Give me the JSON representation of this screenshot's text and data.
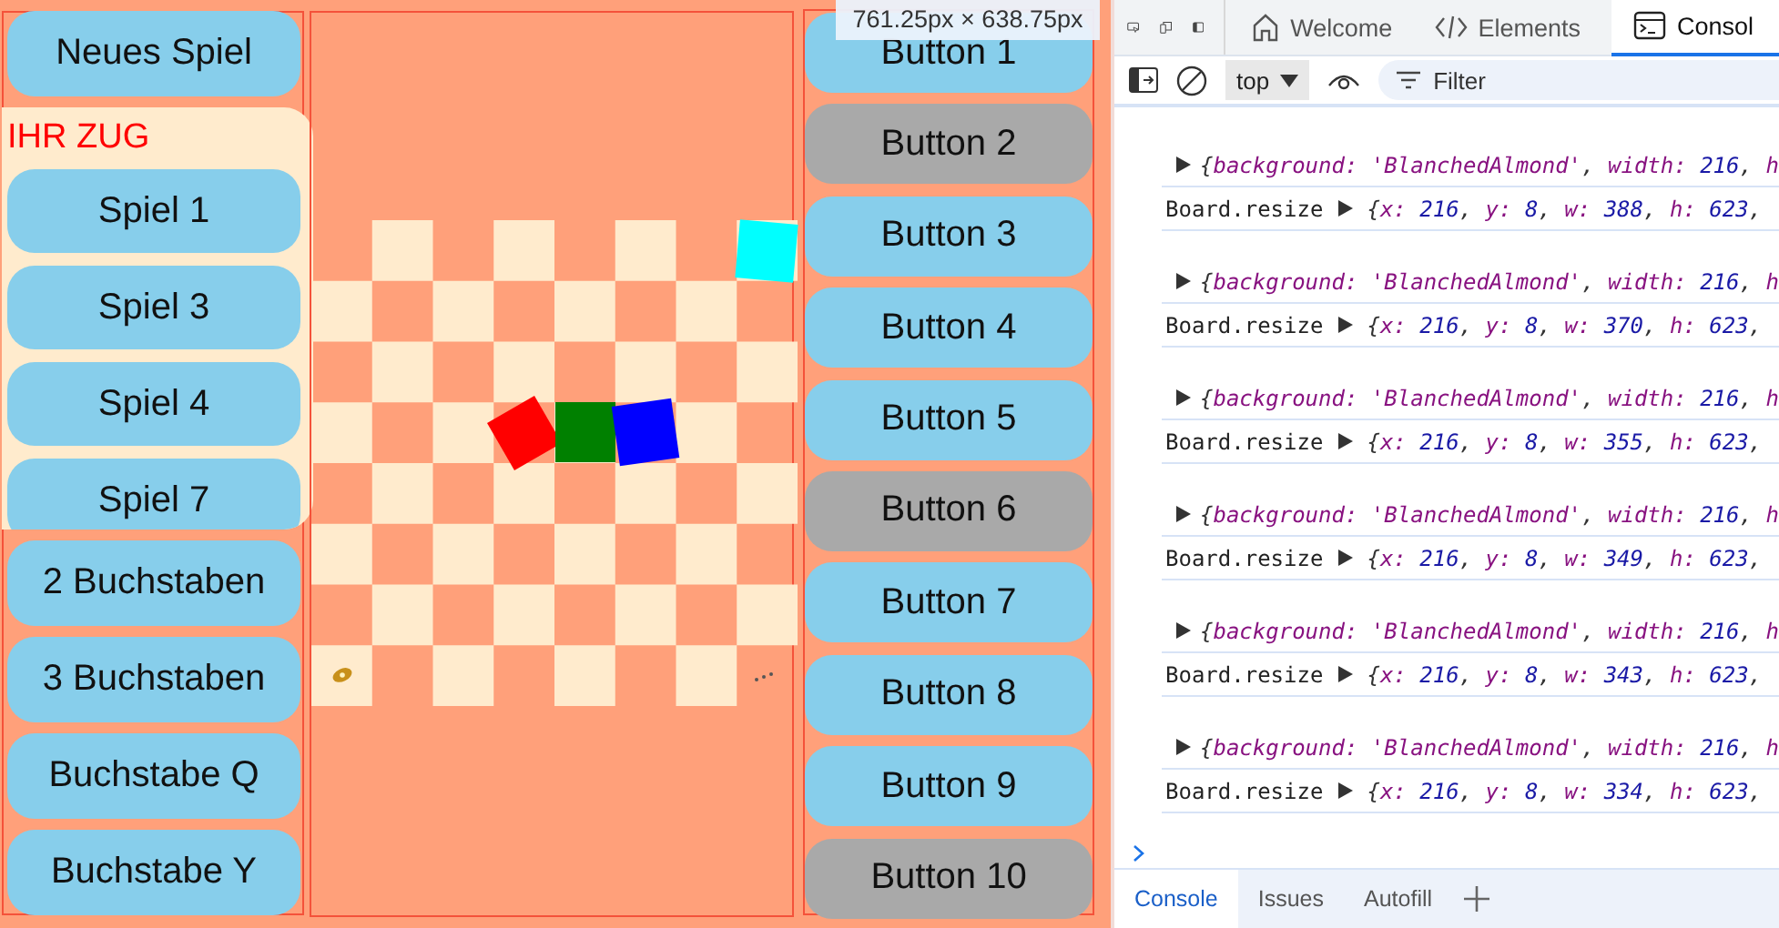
{
  "game": {
    "new_game_button": "Neues Spiel",
    "turn_label": "IHR ZUG",
    "games": [
      "Spiel 1",
      "Spiel 3",
      "Spiel 4",
      "Spiel 7"
    ],
    "letter_buttons": [
      "2 Buchstaben",
      "3 Buchstaben",
      "Buchstabe Q",
      "Buchstabe Y"
    ]
  },
  "board": {
    "pieces": [
      {
        "color": "#00ffff"
      },
      {
        "color": "#ff0000"
      },
      {
        "color": "#008000"
      },
      {
        "color": "#0000ff"
      }
    ]
  },
  "right_buttons": [
    {
      "label": "Button 1",
      "disabled": false
    },
    {
      "label": "Button 2",
      "disabled": true
    },
    {
      "label": "Button 3",
      "disabled": false
    },
    {
      "label": "Button 4",
      "disabled": false
    },
    {
      "label": "Button 5",
      "disabled": false
    },
    {
      "label": "Button 6",
      "disabled": true
    },
    {
      "label": "Button 7",
      "disabled": false
    },
    {
      "label": "Button 8",
      "disabled": false
    },
    {
      "label": "Button 9",
      "disabled": false
    },
    {
      "label": "Button 10",
      "disabled": true
    }
  ],
  "size_tooltip": "761.25px × 638.75px",
  "devtools": {
    "tabs": [
      {
        "label": "Welcome",
        "kind": "home",
        "selected": false
      },
      {
        "label": "Elements",
        "kind": "code",
        "selected": false
      },
      {
        "label": "Consol",
        "kind": "console",
        "selected": true
      }
    ],
    "context": "top",
    "filter_placeholder": "Filter",
    "logs": [
      {
        "object": "{background: 'BlanchedAlmond', width: 216, h",
        "label": "Board.resize",
        "value": "{x: 216, y: 8, w: 388, h: 623,"
      },
      {
        "object": "{background: 'BlanchedAlmond', width: 216, h",
        "label": "Board.resize",
        "value": "{x: 216, y: 8, w: 370, h: 623,"
      },
      {
        "object": "{background: 'BlanchedAlmond', width: 216, h",
        "label": "Board.resize",
        "value": "{x: 216, y: 8, w: 355, h: 623,"
      },
      {
        "object": "{background: 'BlanchedAlmond', width: 216, h",
        "label": "Board.resize",
        "value": "{x: 216, y: 8, w: 349, h: 623,"
      },
      {
        "object": "{background: 'BlanchedAlmond', width: 216, h",
        "label": "Board.resize",
        "value": "{x: 216, y: 8, w: 343, h: 623,"
      },
      {
        "object": "{background: 'BlanchedAlmond', width: 216, h",
        "label": "Board.resize",
        "value": "{x: 216, y: 8, w: 334, h: 623,"
      }
    ],
    "drawer_tabs": [
      {
        "label": "Console",
        "selected": true
      },
      {
        "label": "Issues",
        "selected": false
      },
      {
        "label": "Autofill",
        "selected": false
      }
    ]
  }
}
